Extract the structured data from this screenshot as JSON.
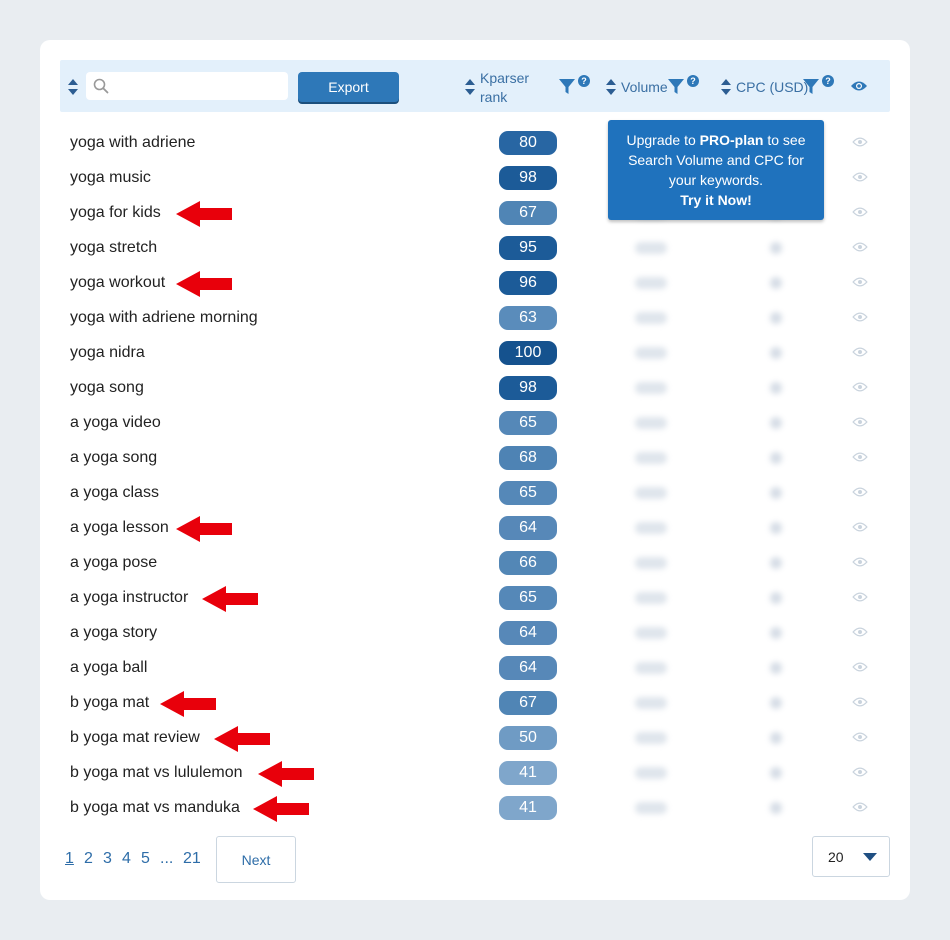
{
  "toolbar": {
    "search_placeholder": "",
    "export_label": "Export"
  },
  "columns": {
    "rank_line1": "Kparser",
    "rank_line2": "rank",
    "volume": "Volume",
    "cpc": "CPC (USD)",
    "help_glyph": "?"
  },
  "upgrade": {
    "prefix": "Upgrade to ",
    "plan": "PRO-plan",
    "suffix": " to see",
    "line2": "Search Volume and CPC for",
    "line3": "your keywords.",
    "cta": "Try it Now!"
  },
  "rows": [
    {
      "keyword": "yoga with adriene",
      "rank": "80",
      "color": "#2866a3",
      "arrow": false
    },
    {
      "keyword": "yoga music",
      "rank": "98",
      "color": "#1c5b98",
      "arrow": false
    },
    {
      "keyword": "yoga for kids",
      "rank": "67",
      "color": "#5085b5",
      "arrow": true
    },
    {
      "keyword": "yoga stretch",
      "rank": "95",
      "color": "#1c5b98",
      "arrow": false
    },
    {
      "keyword": "yoga workout",
      "rank": "96",
      "color": "#1c5b98",
      "arrow": true
    },
    {
      "keyword": "yoga with adriene morning",
      "rank": "63",
      "color": "#5a8cbb",
      "arrow": false
    },
    {
      "keyword": "yoga nidra",
      "rank": "100",
      "color": "#15528e",
      "arrow": false
    },
    {
      "keyword": "yoga song",
      "rank": "98",
      "color": "#1c5b98",
      "arrow": false
    },
    {
      "keyword": "a yoga video",
      "rank": "65",
      "color": "#5588b8",
      "arrow": false
    },
    {
      "keyword": "a yoga song",
      "rank": "68",
      "color": "#4e83b4",
      "arrow": false
    },
    {
      "keyword": "a yoga class",
      "rank": "65",
      "color": "#5588b8",
      "arrow": false
    },
    {
      "keyword": "a yoga lesson",
      "rank": "64",
      "color": "#5788b8",
      "arrow": true
    },
    {
      "keyword": "a yoga pose",
      "rank": "66",
      "color": "#5387b6",
      "arrow": false
    },
    {
      "keyword": "a yoga instructor",
      "rank": "65",
      "color": "#5588b8",
      "arrow": true
    },
    {
      "keyword": "a yoga story",
      "rank": "64",
      "color": "#5788b8",
      "arrow": false
    },
    {
      "keyword": "a yoga ball",
      "rank": "64",
      "color": "#5788b8",
      "arrow": false
    },
    {
      "keyword": "b yoga mat",
      "rank": "67",
      "color": "#5085b5",
      "arrow": true
    },
    {
      "keyword": "b yoga mat review",
      "rank": "50",
      "color": "#6f9bc4",
      "arrow": true
    },
    {
      "keyword": "b yoga mat vs lululemon",
      "rank": "41",
      "color": "#7fa6cb",
      "arrow": true
    },
    {
      "keyword": "b yoga mat vs manduka",
      "rank": "41",
      "color": "#7fa6cb",
      "arrow": true
    }
  ],
  "pagination": {
    "pages": [
      "1",
      "2",
      "3",
      "4",
      "5",
      "...",
      "21"
    ],
    "active": "1",
    "next_label": "Next",
    "per_page": "20"
  },
  "colors": {
    "accent": "#2e78b8",
    "arrow": "#e8000b",
    "header_bg": "#e3f0fb"
  }
}
